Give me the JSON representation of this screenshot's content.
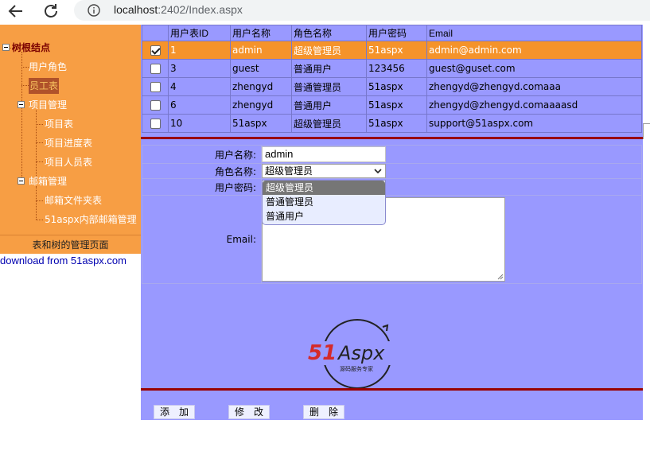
{
  "browser": {
    "url_host": "localhost",
    "url_rest": ":2402/Index.aspx"
  },
  "tree": {
    "root": "树根结点",
    "nodes": [
      {
        "label": "用户角色"
      },
      {
        "label": "员工表"
      },
      {
        "label": "项目管理"
      },
      {
        "label": "项目表"
      },
      {
        "label": "项目进度表"
      },
      {
        "label": "项目人员表"
      },
      {
        "label": "邮箱管理"
      },
      {
        "label": "邮箱文件夹表"
      },
      {
        "label": "51aspx内部邮箱管理"
      }
    ],
    "footer": "表和树的管理页面",
    "download": "download from 51aspx.com"
  },
  "grid": {
    "headers": [
      "用户表ID",
      "用户名称",
      "角色名称",
      "用户密码",
      "Email"
    ],
    "rows": [
      {
        "checked": true,
        "id": "1",
        "name": "admin",
        "role": "超级管理员",
        "pwd": "51aspx",
        "email": "admin@admin.com"
      },
      {
        "checked": false,
        "id": "3",
        "name": "guest",
        "role": "普通用户",
        "pwd": "123456",
        "email": "guest@guset.com"
      },
      {
        "checked": false,
        "id": "4",
        "name": "zhengyd",
        "role": "普通管理员",
        "pwd": "51aspx",
        "email": "zhengyd@zhengyd.comaaa"
      },
      {
        "checked": false,
        "id": "6",
        "name": "zhengyd",
        "role": "普通用户",
        "pwd": "51aspx",
        "email": "zhengyd@zhengyd.comaaaasd"
      },
      {
        "checked": false,
        "id": "10",
        "name": "51aspx",
        "role": "超级管理员",
        "pwd": "51aspx",
        "email": "support@51aspx.com"
      }
    ]
  },
  "form": {
    "username_label": "用户名称:",
    "username_value": "admin",
    "role_label": "角色名称:",
    "role_value": "超级管理员",
    "role_options": [
      "超级管理员",
      "普通管理员",
      "普通用户"
    ],
    "password_label": "用户密码:",
    "email_label": "Email:"
  },
  "logo": {
    "brand_red": "51",
    "brand_rest": "Aspx",
    "tagline": "源码服务专家"
  },
  "buttons": {
    "add": "添　加",
    "edit": "修　改",
    "delete": "删　除"
  },
  "colors": {
    "tree_bg": "#f79e44",
    "main_bg": "#9999ff",
    "selected_row": "#f5932a",
    "separator": "#990000"
  }
}
